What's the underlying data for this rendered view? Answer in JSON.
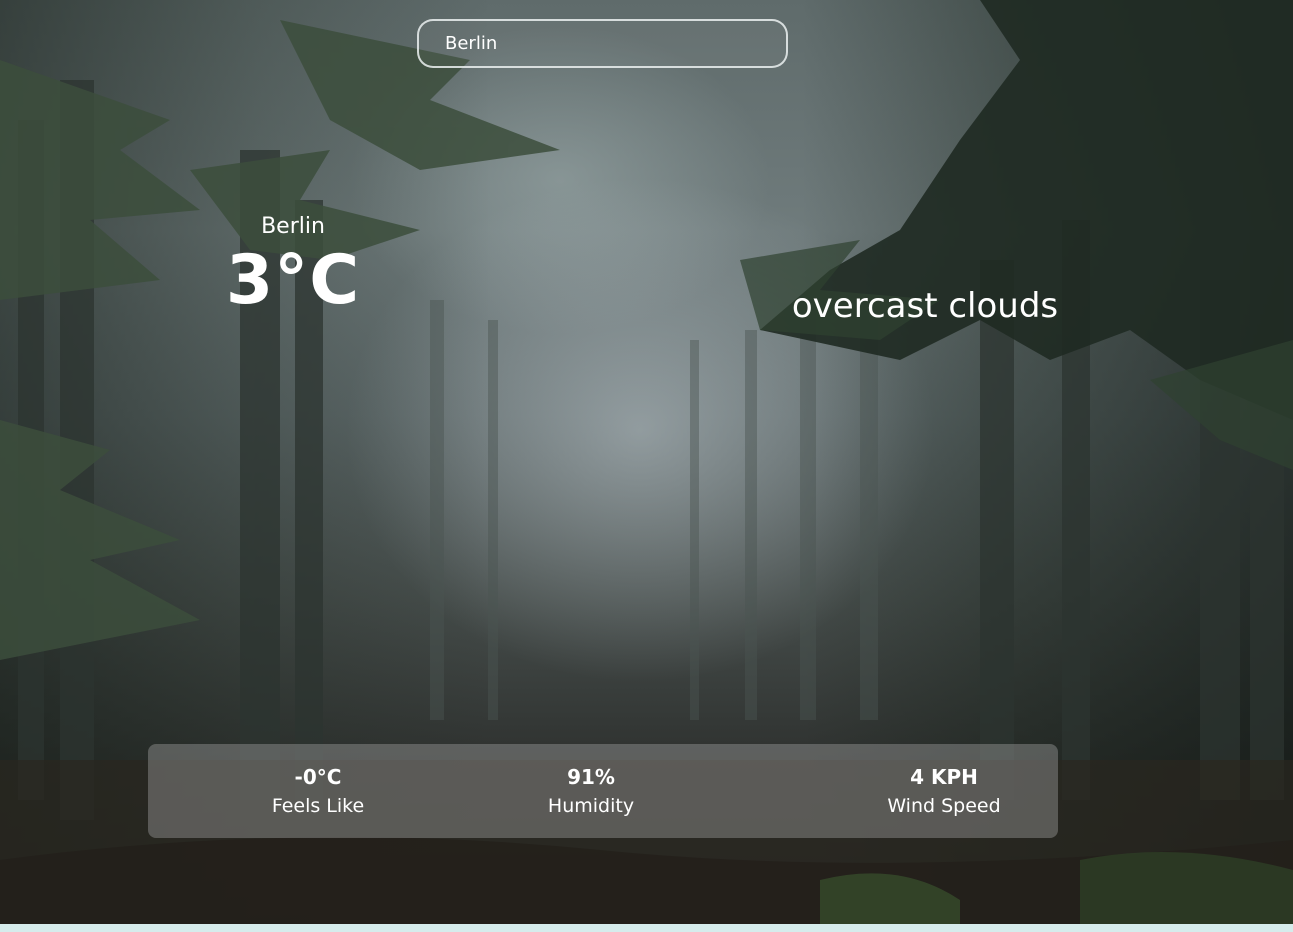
{
  "search": {
    "value": "Berlin"
  },
  "location": {
    "city": "Berlin",
    "temperature": "3°C"
  },
  "weather": {
    "description": "overcast clouds"
  },
  "stats": [
    {
      "value": "-0°C",
      "label": "Feels Like"
    },
    {
      "value": "91%",
      "label": "Humidity"
    },
    {
      "value": "4 KPH",
      "label": "Wind Speed"
    }
  ]
}
